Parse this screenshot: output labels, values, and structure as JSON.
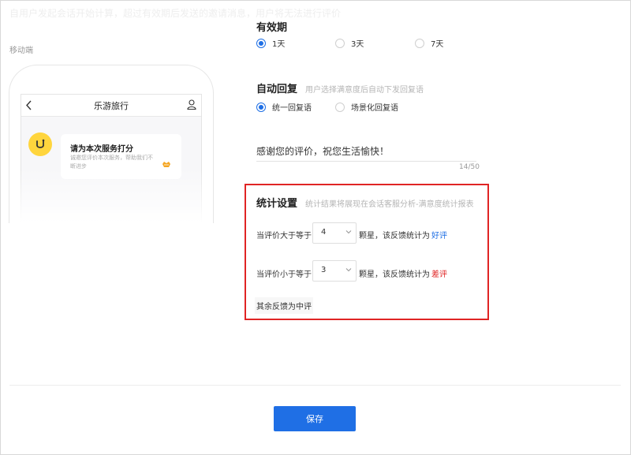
{
  "top_faint_text": "自用户发起会话开始计算，超过有效期后发送的邀请消息，用户将无法进行评价",
  "preview": {
    "label": "移动端",
    "phone_title": "乐游旅行",
    "card_title": "请为本次服务打分",
    "card_desc": "诚邀您评价本次服务，帮助我们不断进步"
  },
  "validity": {
    "title": "有效期",
    "options": [
      {
        "label": "1天",
        "selected": true
      },
      {
        "label": "3天",
        "selected": false
      },
      {
        "label": "7天",
        "selected": false
      }
    ]
  },
  "auto_reply": {
    "title": "自动回复",
    "hint": "用户选择满意度后自动下发回复语",
    "options": [
      {
        "label": "统一回复语",
        "selected": true
      },
      {
        "label": "场景化回复语",
        "selected": false
      }
    ],
    "text": "感谢您的评价，祝您生活愉快！",
    "counter": "14/50"
  },
  "statistics": {
    "title": "统计设置",
    "hint": "统计结果将展现在会话客服分析-满意度统计报表",
    "rows": [
      {
        "prefix": "当评价大于等于",
        "value": "4",
        "suffix": "颗星，该反馈统计为",
        "result": "好评"
      },
      {
        "prefix": "当评价小于等于",
        "value": "3",
        "suffix": "颗星，该反馈统计为",
        "result": "差评"
      }
    ],
    "rest": "其余反馈为中评"
  },
  "save_label": "保存",
  "colors": {
    "accent": "#1f6fe5",
    "negative": "#e02424",
    "avatar": "#ffd53d"
  }
}
